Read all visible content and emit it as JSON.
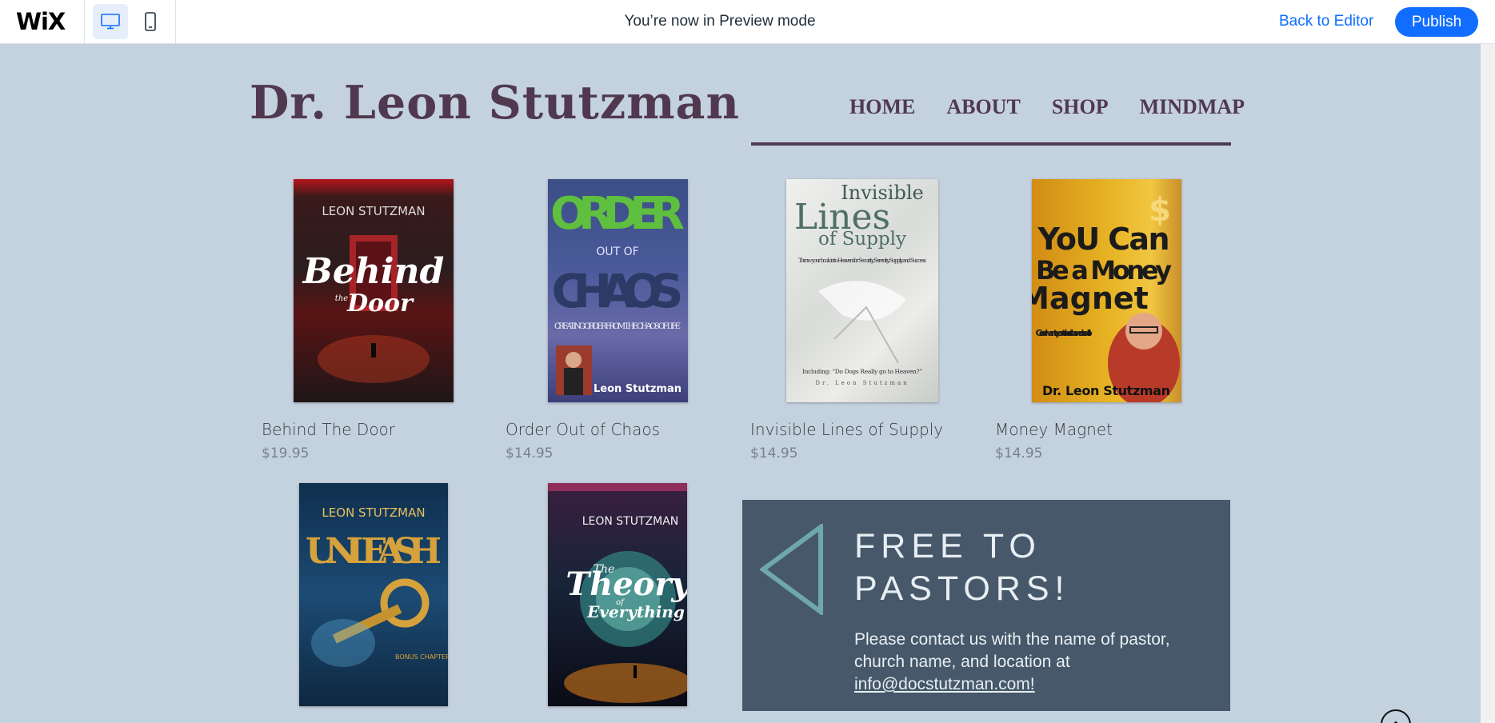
{
  "topbar": {
    "logo": "WiX",
    "preview_message": "You’re now in Preview mode",
    "back_label": "Back to Editor",
    "publish_label": "Publish",
    "devices": [
      "desktop-icon",
      "mobile-icon"
    ]
  },
  "site": {
    "title": "Dr. Leon Stutzman",
    "nav": [
      "HOME",
      "ABOUT",
      "SHOP",
      "MINDMAP"
    ],
    "products": [
      {
        "name": "Behind The Door",
        "price": "$19.95",
        "cover_text": [
          "LEON STUTZMAN",
          "Behind",
          "the",
          "Door"
        ]
      },
      {
        "name": "Order Out of Chaos",
        "price": "$14.95",
        "cover_text": [
          "ORDER",
          "OUT OF",
          "CHAOS",
          "CREATING ORDER FROM THE CHAOS OF LIFE",
          "Leon Stutzman"
        ]
      },
      {
        "name": "Invisible Lines of Supply",
        "price": "$14.95",
        "cover_text": [
          "Invisible",
          "Lines",
          "of Supply",
          "Throw your book into Heaven for Security, Serenity, Supply, and Success",
          "Including: “Do Dogs Really go to Heaven?”",
          "Dr. Leon Stutzman"
        ]
      },
      {
        "name": "Money Magnet",
        "price": "$14.95",
        "cover_text": [
          "YoU Can",
          "Be a Money",
          "Magnet",
          "God wants you to be rich and so do I",
          "Dr. Leon Stutzman"
        ]
      },
      {
        "name": "",
        "price": "",
        "cover_text": [
          "LEON STUTZMAN",
          "UNLEASH",
          "BONUS CHAPTER"
        ]
      },
      {
        "name": "",
        "price": "",
        "cover_text": [
          "LEON STUTZMAN",
          "The",
          "Theory",
          "of",
          "Everything"
        ]
      }
    ],
    "promo": {
      "title": "FREE TO PASTORS!",
      "text": "Please contact us with the name of pastor, church name, and location at ",
      "email": "info@docstutzman.com!"
    }
  },
  "colors": {
    "site_bg": "#c4d1df",
    "brand": "#50394f",
    "promo_bg": "#465869",
    "accent": "#116dff"
  }
}
